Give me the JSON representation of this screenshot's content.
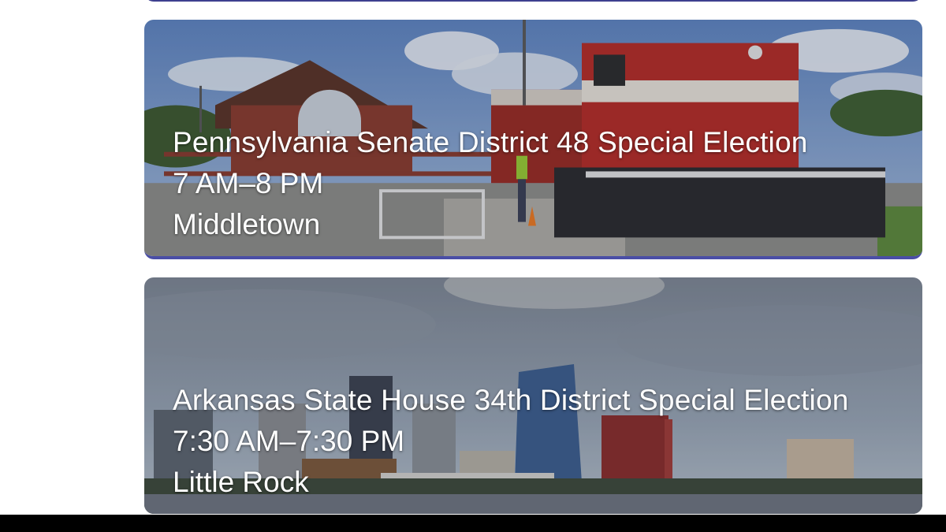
{
  "events": [
    {
      "title": "Pennsylvania Senate District 48 Special Election",
      "time": "7 AM–8 PM",
      "location": "Middletown",
      "image": "train-station-photo"
    },
    {
      "title": "Arkansas State House 34th District Special Election",
      "time": "7:30 AM–7:30 PM",
      "location": "Little Rock",
      "image": "city-skyline-photo"
    }
  ],
  "colors": {
    "card_accent": "#4a4ea6",
    "text": "#ffffff",
    "background": "#ffffff"
  }
}
